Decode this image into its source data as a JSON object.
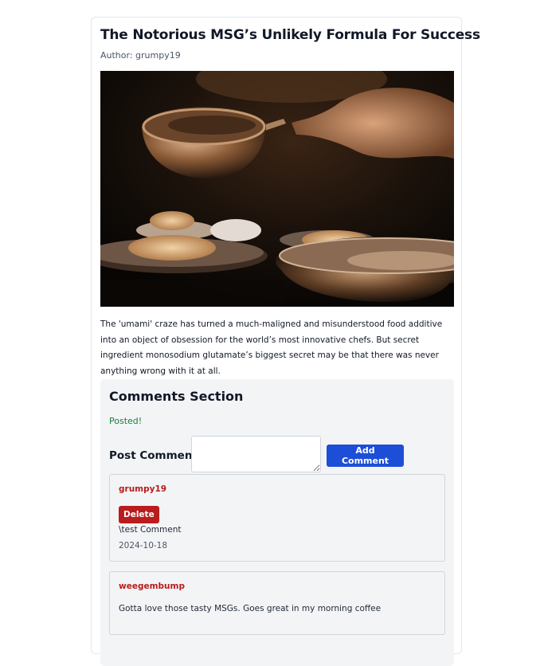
{
  "article": {
    "title": "The Notorious MSG’s Unlikely Formula For Success",
    "author": "Author: grumpy19",
    "body": "The 'umami' craze has turned a much-maligned and misunderstood food additive into an object of obsession for the world’s most innovative chefs. But secret ingredient monosodium glutamate’s biggest secret may be that there was never anything wrong with it at all."
  },
  "comments_section": {
    "heading": "Comments Section",
    "status": "Posted!",
    "post_label": "Post Comment",
    "textarea_value": "",
    "add_button": "Add Comment",
    "comments": [
      {
        "author": "grumpy19",
        "delete_label": "Delete",
        "text": "\\test Comment",
        "date": "2024-10-18"
      },
      {
        "author": "weegembump",
        "text": "Gotta love those tasty MSGs. Goes great in my morning coffee"
      }
    ]
  },
  "colors": {
    "primary_button": "#1d4ed8",
    "danger": "#b91c1c",
    "success": "#15803d",
    "panel": "#f3f4f6"
  }
}
